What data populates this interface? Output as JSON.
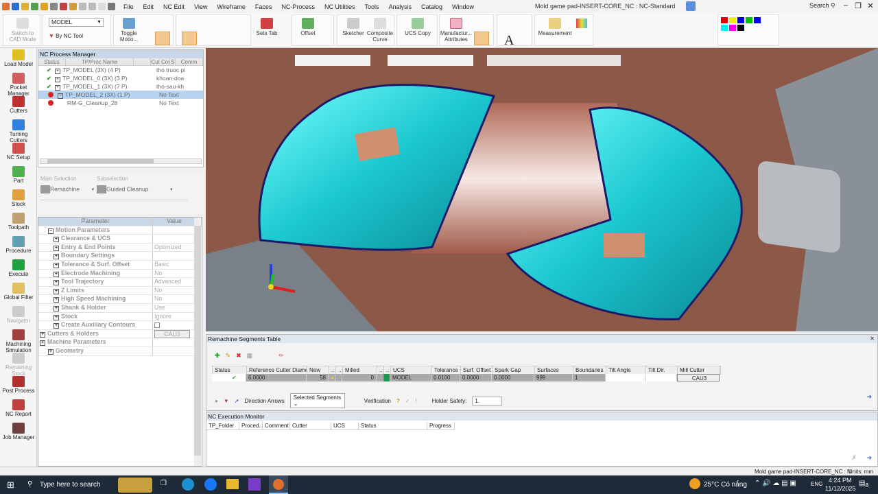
{
  "app": {
    "title": "Mold game pad-INSERT-CORE_NC : NC-Standard",
    "search": "Search"
  },
  "menu": [
    "File",
    "Edit",
    "NC Edit",
    "View",
    "Wireframe",
    "Faces",
    "NC-Process",
    "NC Utilities",
    "Tools",
    "Analysis",
    "Catalog",
    "Window"
  ],
  "toolbar": {
    "switch_cad": "Switch to CAD Mode",
    "model_select": "MODEL",
    "by_nc_tool": "By NC Tool",
    "toggle_motion": "Toggle Motio...",
    "sets_tab": "Sets Tab",
    "offset": "Offset",
    "sketcher": "Sketcher",
    "composite_curve": "Composite Curve",
    "ucs_copy": "UCS Copy",
    "manufacturing_attributes": "Manufactur... Attributes",
    "measurement": "Measurement"
  },
  "colors": {
    "palette": [
      "#e00000",
      "#f0f000",
      "#0000e0",
      "#00c000",
      "#0000ff",
      "#00f0f0",
      "#f000f0",
      "#000000"
    ]
  },
  "leftbar": [
    {
      "label": "Load Model",
      "color": "#e0c020"
    },
    {
      "label": "Pocket Manager",
      "color": "#d06060"
    },
    {
      "label": "Cutters",
      "color": "#c03030"
    },
    {
      "label": "Turning Cutters",
      "color": "#3080e0"
    },
    {
      "label": "NC Setup",
      "color": "#d05050"
    },
    {
      "label": "Part",
      "color": "#50b050"
    },
    {
      "label": "Stock",
      "color": "#e0a040"
    },
    {
      "label": "Toolpath",
      "color": "#c0a070"
    },
    {
      "label": "Procedure",
      "color": "#60a0b0"
    },
    {
      "label": "Execute",
      "color": "#20a040"
    },
    {
      "label": "Global Filter",
      "color": "#e0c060"
    },
    {
      "label": "Navigator",
      "color": "#cccccc",
      "disabled": true
    },
    {
      "label": "Machining Simulation",
      "color": "#a04040"
    },
    {
      "label": "Remaining Stock",
      "color": "#cccccc",
      "disabled": true
    },
    {
      "label": "Post Process",
      "color": "#b03030"
    },
    {
      "label": "NC Report",
      "color": "#c04040"
    },
    {
      "label": "Job Manager",
      "color": "#704040"
    }
  ],
  "nc_process_manager": {
    "title": "NC Process Manager",
    "columns": [
      "Status",
      "TP/Proc Name",
      "",
      "Cut Cont",
      "S",
      "Comm"
    ],
    "rows": [
      {
        "status": "ok",
        "name": "TP_MODEL (3X) (4 P)",
        "comment": "tho truoc pi"
      },
      {
        "status": "ok",
        "name": "TP_MODEL_0 (3X) (3 P)",
        "comment": "khoan-doa"
      },
      {
        "status": "ok",
        "name": "TP_MODEL_1 (3X) (7 P)",
        "comment": "tho-sau-kh"
      },
      {
        "status": "error",
        "name": "TP_MODEL_2 (3X) (1 P)",
        "comment": "No Text",
        "selected": true
      },
      {
        "status": "error",
        "name": "RM-G_Cleanup_28",
        "comment": "No Text",
        "child": true
      }
    ]
  },
  "selection": {
    "main_label": "Main Selection",
    "main_value": "Remachine",
    "sub_label": "Subselection",
    "sub_value": "Guided Cleanup"
  },
  "parameters": {
    "header": [
      "Parameter",
      "Value"
    ],
    "rows": [
      {
        "name": "Motion Parameters",
        "value": "",
        "level": 0,
        "expanded": true
      },
      {
        "name": "Clearance & UCS",
        "value": "",
        "level": 1
      },
      {
        "name": "Entry & End Points",
        "value": "Optimized",
        "level": 1
      },
      {
        "name": "Boundary Settings",
        "value": "",
        "level": 1
      },
      {
        "name": "Tolerance & Surf. Offset",
        "value": "Basic",
        "level": 1
      },
      {
        "name": "Electrode Machining",
        "value": "No",
        "level": 1
      },
      {
        "name": "Tool Trajectory",
        "value": "Advanced",
        "level": 1
      },
      {
        "name": "Z Limits",
        "value": "No",
        "level": 1
      },
      {
        "name": "High Speed Machining",
        "value": "No",
        "level": 1
      },
      {
        "name": "Shank & Holder",
        "value": "Use",
        "level": 1
      },
      {
        "name": "Stock",
        "value": "Ignore",
        "level": 1
      },
      {
        "name": "Create Auxiliary Contours",
        "value": "",
        "level": 1,
        "checkbox": true
      },
      {
        "name": "Cutters & Holders",
        "value": "CAU3",
        "level": -1,
        "button": true
      },
      {
        "name": "Machine Parameters",
        "value": "",
        "level": -1
      },
      {
        "name": "Geometry",
        "value": "",
        "level": 0
      }
    ]
  },
  "remachine": {
    "title": "Remachine Segments Table",
    "columns": [
      "Status",
      "Reference Cutter Diameter",
      "New",
      "..",
      "..",
      "Milled",
      "..",
      "..",
      "UCS",
      "Tolerance",
      "Surf. Offset",
      "Spark Gap",
      "Surfaces",
      "Boundaries",
      "Tilt Angle",
      "Tilt Dir.",
      "Mill Cutter"
    ],
    "row": {
      "ref_diameter": "6.0000",
      "new": "58",
      "milled": "0",
      "ucs": "MODEL",
      "tolerance": "0.0100",
      "surf_offset": "0.0000",
      "spark_gap": "0.0000",
      "surfaces": "999",
      "boundaries": "1",
      "tilt_angle": "",
      "tilt_dir": "",
      "mill_cutter": "CAU3"
    },
    "direction_label": "Direction Arrows",
    "direction_value": "Selected Segments",
    "verification_label": "Verification",
    "holder_label": "Holder Safety:",
    "holder_value": "1."
  },
  "exec_monitor": {
    "title": "NC Execution Monitor",
    "columns": [
      "TP_Folder",
      "Proced...",
      "Comment",
      "Cutter",
      "UCS",
      "Status",
      "Progress"
    ]
  },
  "statusbar": {
    "file": "Mold game pad-INSERT-CORE_NC : N",
    "units": "Units: mm"
  },
  "taskbar": {
    "search": "Type here to search",
    "weather": "25°C  Có nắng",
    "lang": "ENG",
    "time": "4:24 PM",
    "date": "11/12/2025",
    "notifications": "8"
  }
}
